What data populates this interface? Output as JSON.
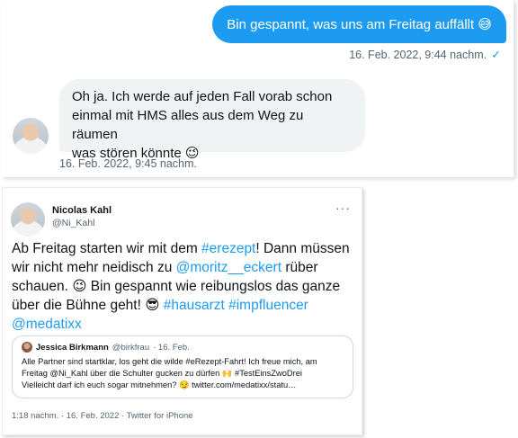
{
  "dm": {
    "outgoing": {
      "text": "Bin gespannt, was uns am Freitag auffällt",
      "emoji": "😅",
      "timestamp": "16. Feb. 2022, 9:44 nachm.",
      "status_icon": "✓"
    },
    "incoming": {
      "line1": "Oh ja. Ich werde auf jeden Fall vorab schon",
      "line2": "einmal mit HMS alles aus dem Weg zu räumen",
      "line3": "was stören könnte",
      "emoji": "😉",
      "timestamp": "16. Feb. 2022, 9:45 nachm."
    }
  },
  "tweet": {
    "author": "Nicolas Kahl",
    "handle": "@Ni_Kahl",
    "more": "···",
    "text": {
      "p1": "Ab Freitag starten wir mit dem ",
      "tag_erezept": "#erezept",
      "p2": "! Dann müssen wir nicht mehr neidisch zu ",
      "mention": "@moritz__eckert",
      "p3": " rüber schauen. ",
      "emoji1": "😉",
      "p4": " Bin gespannt wie reibungslos das ganze über die Bühne geht! ",
      "emoji2": "😎",
      "tag_hausarzt": "#hausarzt",
      "tag_impf": "#impfluencer",
      "tag_medatixx": "@medatixx"
    },
    "quote": {
      "author": "Jessica Birkmann",
      "handle": "@birkfrau",
      "date": "· 16. Feb.",
      "line1": "Alle Partner sind startklar, los geht die wilde #eRezept-Fahrt! Ich freue mich, am",
      "line2": "Freitag @Ni_Kahl über die Schulter gucken zu dürfen 🙌 #TestEinsZwoDrei",
      "line3": "Vielleicht darf ich euch sogar mitnehmen? 😏 twitter.com/medatixx/statu…"
    },
    "footer": "1:18 nachm. · 16. Feb. 2022 · Twitter for iPhone"
  }
}
